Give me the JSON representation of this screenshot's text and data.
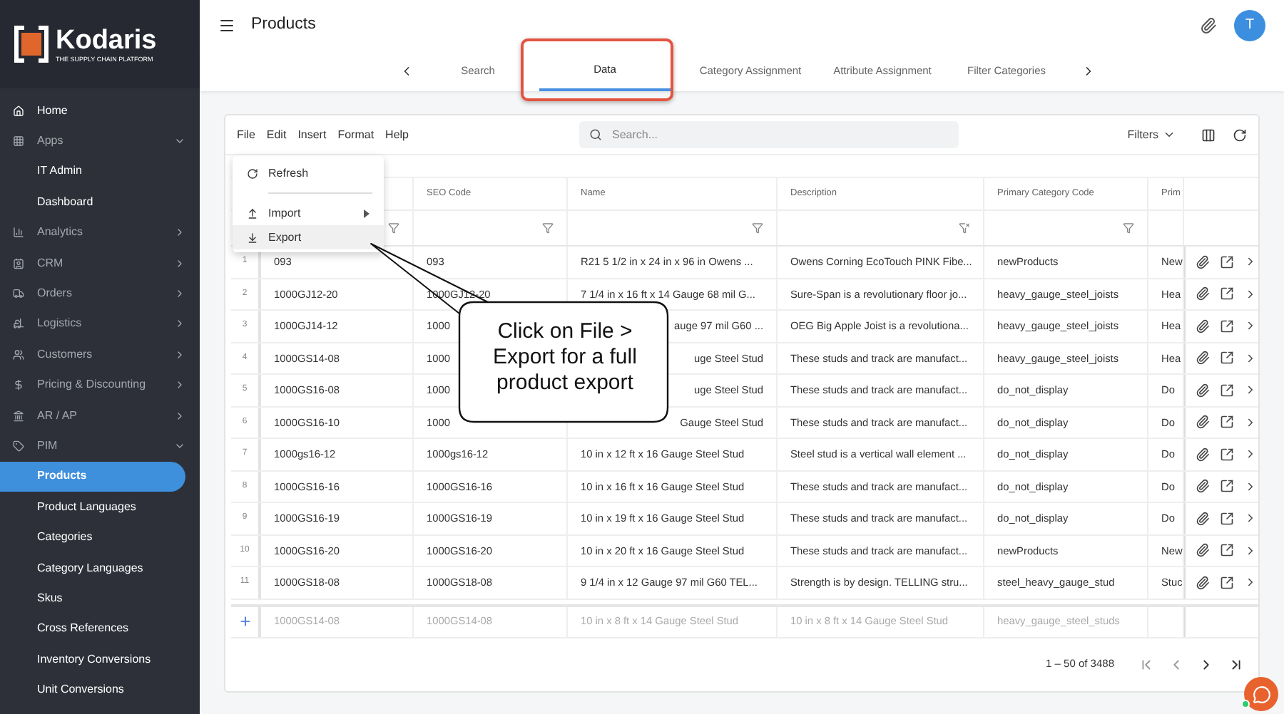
{
  "sidebar": {
    "brand": "Kodaris",
    "tagline": "THE SUPPLY CHAIN PLATFORM",
    "items": [
      {
        "label": "Home"
      },
      {
        "label": "Apps",
        "expanded": true,
        "children": [
          {
            "label": "IT Admin",
            "selected": false
          },
          {
            "label": "Dashboard",
            "selected": false
          }
        ]
      },
      {
        "label": "Analytics",
        "expanded": false
      },
      {
        "label": "CRM",
        "expanded": false
      },
      {
        "label": "Orders",
        "expanded": false
      },
      {
        "label": "Logistics",
        "expanded": false
      },
      {
        "label": "Customers",
        "expanded": false
      },
      {
        "label": "Pricing & Discounting",
        "expanded": false
      },
      {
        "label": "AR / AP",
        "expanded": false
      },
      {
        "label": "PIM",
        "expanded": true,
        "children": [
          {
            "label": "Products",
            "selected": true
          },
          {
            "label": "Product Languages",
            "selected": false
          },
          {
            "label": "Categories",
            "selected": false
          },
          {
            "label": "Category Languages",
            "selected": false
          },
          {
            "label": "Skus",
            "selected": false
          },
          {
            "label": "Cross References",
            "selected": false
          },
          {
            "label": "Inventory Conversions",
            "selected": false
          },
          {
            "label": "Unit Conversions",
            "selected": false
          }
        ]
      }
    ]
  },
  "header": {
    "title": "Products",
    "avatar": "T"
  },
  "tabs": [
    {
      "label": "Search",
      "selected": false
    },
    {
      "label": "Data",
      "selected": true
    },
    {
      "label": "Category Assignment",
      "selected": false
    },
    {
      "label": "Attribute Assignment",
      "selected": false
    },
    {
      "label": "Filter Categories",
      "selected": false
    }
  ],
  "toolbar": {
    "menus": [
      "File",
      "Edit",
      "Insert",
      "Format",
      "Help"
    ],
    "search": {
      "placeholder": "Search..."
    },
    "filters": "Filters"
  },
  "file_menu": [
    {
      "kind": "refresh",
      "label": "Refresh",
      "selected": false
    },
    {
      "kind": "divider"
    },
    {
      "kind": "import",
      "label": "Import",
      "selected": false
    },
    {
      "kind": "export",
      "label": "Export",
      "selected": true
    }
  ],
  "table": {
    "columns": [
      {
        "filter": true,
        "cleared": false
      },
      {
        "label": "SEO Code",
        "filter": true,
        "cleared": false
      },
      {
        "label": "Name",
        "filter": true,
        "cleared": false
      },
      {
        "label": "Description",
        "filter": true,
        "cleared": true
      },
      {
        "label": "Primary Category Code",
        "filter": true,
        "cleared": false
      },
      {
        "label": "Prim",
        "filter": false
      }
    ],
    "rows": [
      {
        "num": "1",
        "cells": [
          "093",
          "093",
          "R21 5 1/2 in x 24 in x 96 in Owens ...",
          "Owens Corning EcoTouch PINK Fibe...",
          "newProducts",
          "New"
        ]
      },
      {
        "num": "2",
        "cells": [
          "1000GJ12-20",
          "1000GJ12-20",
          "7 1/4 in x 16 ft x 14 Gauge 68 mil G...",
          "Sure-Span is a revolutionary floor jo...",
          "heavy_gauge_steel_joists",
          "Hea"
        ]
      },
      {
        "num": "3",
        "cells": [
          "1000GJ14-12",
          "1000",
          "auge 97 mil G60 ...",
          "OEG Big Apple Joist is a revolutiona...",
          "heavy_gauge_steel_joists",
          "Hea"
        ],
        "covered": true
      },
      {
        "num": "4",
        "cells": [
          "1000GS14-08",
          "1000",
          "uge Steel Stud",
          "These studs and track are manufact...",
          "heavy_gauge_steel_joists",
          "Hea"
        ],
        "covered": true
      },
      {
        "num": "5",
        "cells": [
          "1000GS16-08",
          "1000",
          "uge Steel Stud",
          "These studs and track are manufact...",
          "do_not_display",
          "Do"
        ],
        "covered": true
      },
      {
        "num": "6",
        "cells": [
          "1000GS16-10",
          "1000",
          "Gauge Steel Stud",
          "These studs and track are manufact...",
          "do_not_display",
          "Do"
        ],
        "covered": true
      },
      {
        "num": "7",
        "cells": [
          "1000gs16-12",
          "1000gs16-12",
          "10 in x 12 ft x 16 Gauge Steel Stud",
          "Steel stud is a vertical wall element ...",
          "do_not_display",
          "Do"
        ]
      },
      {
        "num": "8",
        "cells": [
          "1000GS16-16",
          "1000GS16-16",
          "10 in x 16 ft x 16 Gauge Steel Stud",
          "These studs and track are manufact...",
          "do_not_display",
          "Do"
        ]
      },
      {
        "num": "9",
        "cells": [
          "1000GS16-19",
          "1000GS16-19",
          "10 in x 19 ft x 16 Gauge Steel Stud",
          "These studs and track are manufact...",
          "do_not_display",
          "Do"
        ]
      },
      {
        "num": "10",
        "cells": [
          "1000GS16-20",
          "1000GS16-20",
          "10 in x 20 ft x 16 Gauge Steel Stud",
          "These studs and track are manufact...",
          "newProducts",
          "New"
        ]
      },
      {
        "num": "11",
        "cells": [
          "1000GS18-08",
          "1000GS18-08",
          "9 1/4 in x 12 Gauge 97 mil G60 TEL...",
          "Strength is by design. TELLING stru...",
          "steel_heavy_gauge_stud",
          "Stuc"
        ]
      }
    ],
    "new_row": {
      "placeholders": [
        "1000GS14-08",
        "1000GS14-08",
        "10 in x 8 ft x 14 Gauge Steel Stud",
        "10 in x 8 ft x 14 Gauge Steel Stud",
        "heavy_gauge_steel_studs"
      ]
    }
  },
  "pagination": {
    "range": "1 – 50 of 3488"
  },
  "callout": {
    "text": "Click on File > Export for a full product export"
  }
}
